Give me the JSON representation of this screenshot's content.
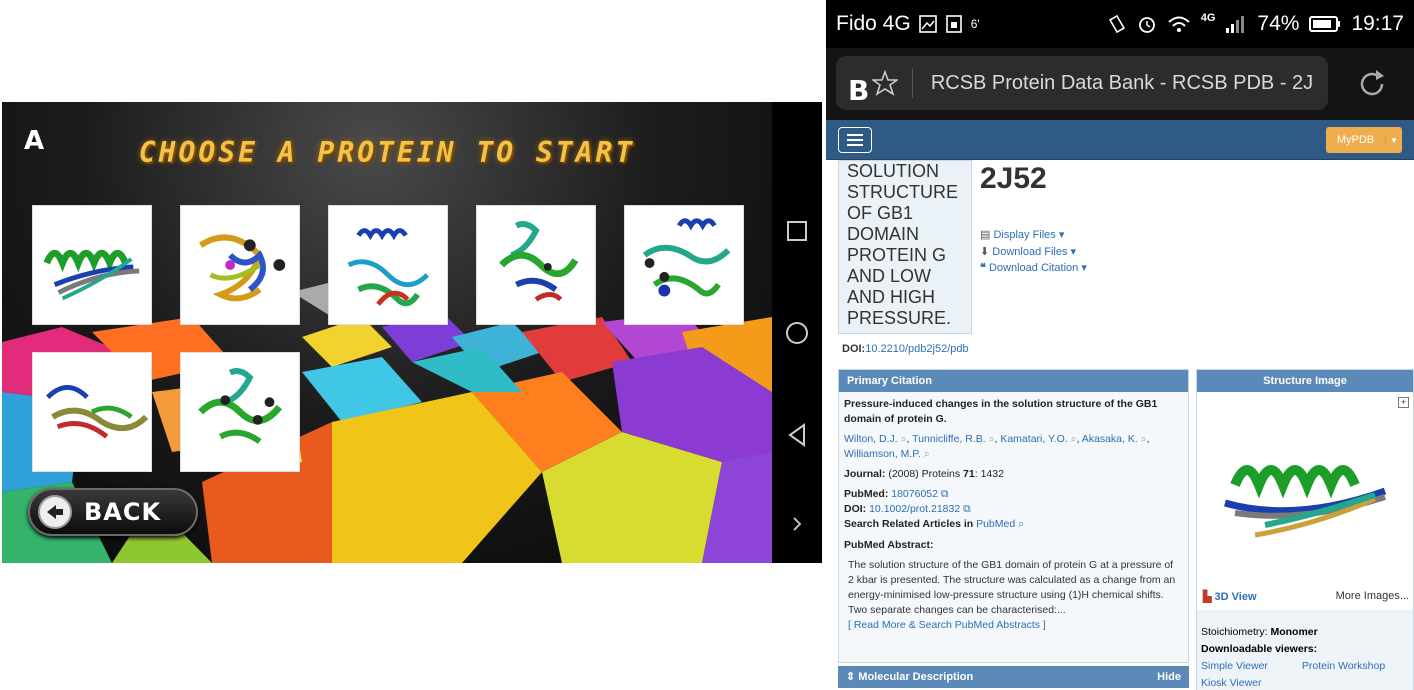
{
  "panel_a": {
    "letter": "A",
    "title": "CHOOSE A PROTEIN TO START",
    "back_label": "BACK",
    "icons": {
      "back": "back-arrow-icon",
      "recent": "square-icon",
      "home": "circle-icon",
      "nav_back": "triangle-back-icon",
      "expand": "chevron-right-icon"
    }
  },
  "panel_b": {
    "letter": "B",
    "status_bar": {
      "carrier": "Fido 4G",
      "battery": "74%",
      "time": "19:17",
      "signal_label": "4G",
      "small": "6'"
    },
    "address_bar": {
      "text": "RCSB Protein Data Bank - RCSB PDB - 2J"
    },
    "nav": {
      "mypdb": "MyPDB"
    },
    "title_box": "SOLUTION STRUCTURE OF GB1 DOMAIN PROTEIN G AND LOW AND HIGH PRESSURE.",
    "pdb_id": "2J52",
    "file_links": {
      "display": "Display Files ▾",
      "download": "Download Files ▾",
      "citation": "Download Citation ▾"
    },
    "doi_label": "DOI:",
    "doi_value": "10.2210/pdb2j52/pdb",
    "primary_citation": {
      "header": "Primary Citation",
      "title": "Pressure-induced changes in the solution structure of the GB1 domain of protein G.",
      "authors": [
        "Wilton, D.J.",
        "Tunnicliffe, R.B.",
        "Kamatari, Y.O.",
        "Akasaka, K.",
        "Williamson, M.P."
      ],
      "journal_label": "Journal:",
      "journal_text": " (2008) Proteins ",
      "journal_volume": "71",
      "journal_page": ": 1432",
      "pubmed_label": "PubMed:",
      "pubmed_id": "18076052",
      "doi_label": "DOI:",
      "doi_value": "10.1002/prot.21832",
      "search_prefix": "Search Related Articles in ",
      "search_link": "PubMed",
      "abstract_label": "PubMed Abstract:",
      "abstract": "The solution structure of the GB1 domain of protein G at a pressure of 2 kbar is presented. The structure was calculated as a change from an energy-minimised low-pressure structure using (1)H chemical shifts. Two separate changes can be characterised:...",
      "read_more": "[ Read More & Search PubMed Abstracts ]"
    },
    "structure_image": {
      "header": "Structure Image",
      "view3d": "3D View",
      "more_images": "More Images...",
      "stoich_label": "Stoichiometry: ",
      "stoich_value": "Monomer",
      "viewers_label": "Downloadable viewers:",
      "viewer1": "Simple Viewer",
      "viewer2": "Protein Workshop",
      "viewer3": "Kiosk Viewer"
    },
    "molecular_description": {
      "header": "Molecular Description",
      "hide": "Hide"
    }
  }
}
